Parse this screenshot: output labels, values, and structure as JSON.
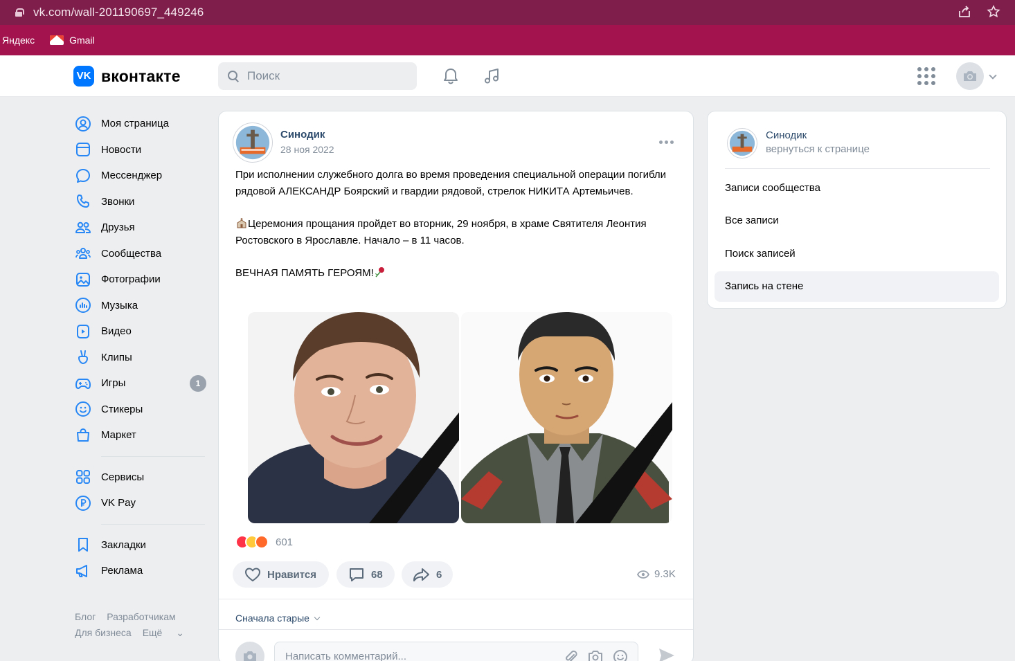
{
  "browser": {
    "url": "vk.com/wall-201190697_449246",
    "bookmarks": [
      "Яндекс",
      "Gmail"
    ]
  },
  "header": {
    "logo": "VK",
    "brand": "вконтакте",
    "search_placeholder": "Поиск"
  },
  "nav": {
    "items": [
      {
        "label": "Моя страница",
        "icon": "user-circle-icon"
      },
      {
        "label": "Новости",
        "icon": "news-icon"
      },
      {
        "label": "Мессенджер",
        "icon": "message-icon"
      },
      {
        "label": "Звонки",
        "icon": "phone-icon"
      },
      {
        "label": "Друзья",
        "icon": "friends-icon"
      },
      {
        "label": "Сообщества",
        "icon": "communities-icon"
      },
      {
        "label": "Фотографии",
        "icon": "photo-icon"
      },
      {
        "label": "Музыка",
        "icon": "music-icon"
      },
      {
        "label": "Видео",
        "icon": "video-icon"
      },
      {
        "label": "Клипы",
        "icon": "clips-icon"
      },
      {
        "label": "Игры",
        "icon": "gamepad-icon",
        "badge": "1"
      },
      {
        "label": "Стикеры",
        "icon": "smile-icon"
      },
      {
        "label": "Маркет",
        "icon": "bag-icon"
      }
    ],
    "items2": [
      {
        "label": "Сервисы",
        "icon": "services-icon"
      },
      {
        "label": "VK Pay",
        "icon": "vkpay-icon"
      }
    ],
    "items3": [
      {
        "label": "Закладки",
        "icon": "bookmark-icon"
      },
      {
        "label": "Реклама",
        "icon": "megaphone-icon"
      }
    ],
    "footer": [
      "Блог",
      "Разработчикам",
      "Для бизнеса",
      "Ещё"
    ]
  },
  "post": {
    "author": "Синодик",
    "date": "28 ноя 2022",
    "paragraph1": "При исполнении служебного долга во время проведения специальной операции погибли рядовой АЛЕКСАНДР Боярский и гвардии рядовой, стрелок НИКИТА Артемьичев.",
    "paragraph2": "Церемония прощания пройдет во вторник, 29 ноября, в храме Святителя Леонтия Ростовского в Ярославле. Начало – в 11 часов.",
    "paragraph3": "ВЕЧНАЯ ПАМЯТЬ ГЕРОЯМ!",
    "reactions_count": "601",
    "like_label": "Нравится",
    "comments": "68",
    "shares": "6",
    "views": "9.3K",
    "sort_label": "Сначала старые",
    "comment_placeholder": "Написать комментарий..."
  },
  "sidebar": {
    "group_name": "Синодик",
    "back_label": "вернуться к странице",
    "items": [
      "Записи сообщества",
      "Все записи",
      "Поиск записей",
      "Запись на стене"
    ],
    "active_index": 3
  },
  "colors": {
    "vk_blue": "#0077ff",
    "link": "#2c4a6b",
    "secondary": "#818c99",
    "page_bg": "#edeef0",
    "browser_top": "#7f1d4b",
    "browser_bookmarks": "#a3144f"
  }
}
